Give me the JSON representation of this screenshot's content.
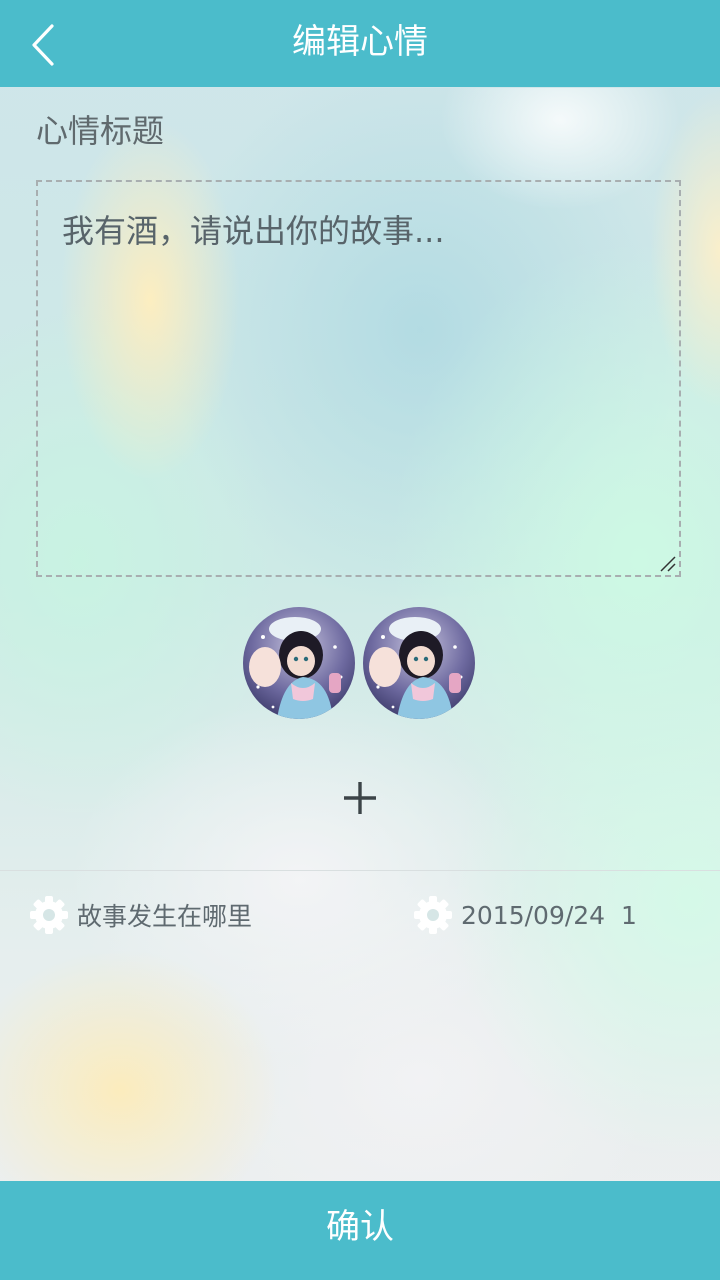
{
  "header": {
    "title": "编辑心情",
    "back_icon": "chevron-left-icon"
  },
  "form": {
    "title_label": "心情标题",
    "story_placeholder": "我有酒，请说出你的故事...",
    "story_value": ""
  },
  "photos": [
    {
      "alt": "anime girl avatar"
    },
    {
      "alt": "anime girl avatar"
    }
  ],
  "add_icon": "plus-icon",
  "location": {
    "icon": "gear-icon",
    "text": "故事发生在哪里"
  },
  "datetime": {
    "icon": "gear-icon",
    "text": "2015/09/24  1"
  },
  "confirm_label": "确认",
  "colors": {
    "accent": "#4bbccb",
    "text_gray": "#5f6a70"
  }
}
